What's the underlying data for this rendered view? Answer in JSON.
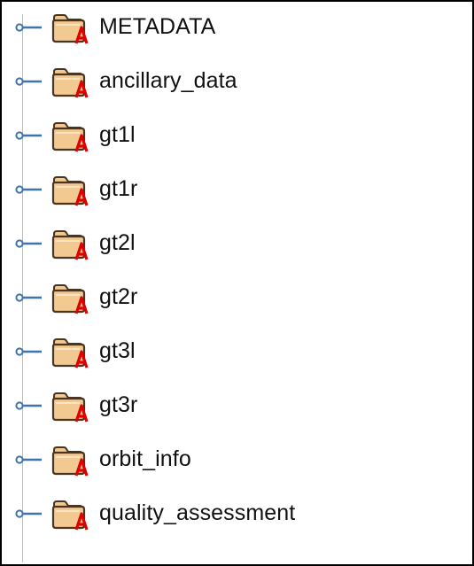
{
  "tree": {
    "nodes": [
      {
        "label": "METADATA",
        "icon": "folder-attribute-icon"
      },
      {
        "label": "ancillary_data",
        "icon": "folder-attribute-icon"
      },
      {
        "label": "gt1l",
        "icon": "folder-attribute-icon"
      },
      {
        "label": "gt1r",
        "icon": "folder-attribute-icon"
      },
      {
        "label": "gt2l",
        "icon": "folder-attribute-icon"
      },
      {
        "label": "gt2r",
        "icon": "folder-attribute-icon"
      },
      {
        "label": "gt3l",
        "icon": "folder-attribute-icon"
      },
      {
        "label": "gt3r",
        "icon": "folder-attribute-icon"
      },
      {
        "label": "orbit_info",
        "icon": "folder-attribute-icon"
      },
      {
        "label": "quality_assessment",
        "icon": "folder-attribute-icon"
      }
    ],
    "expand_handle_icon": "tree-expand-handle-icon"
  },
  "colors": {
    "tree_line": "#a9c0d9",
    "handle": "#3f74ad",
    "folder_fill": "#f3c992",
    "folder_outline": "#4a3520",
    "attribute_mark": "#e00000",
    "text": "#111111"
  }
}
